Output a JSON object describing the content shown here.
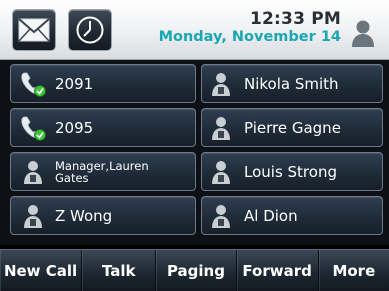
{
  "header": {
    "time": "12:33 PM",
    "date": "Monday, November 14",
    "icons": [
      "envelope-icon",
      "clock-icon",
      "user-avatar-icon"
    ]
  },
  "lines": [
    {
      "label": "2091",
      "icon": "phone-line-icon"
    },
    {
      "label": "Nikola Smith",
      "icon": "contact-icon"
    },
    {
      "label": "2095",
      "icon": "phone-line-icon"
    },
    {
      "label": "Pierre Gagne",
      "icon": "contact-icon"
    },
    {
      "label": "Manager,Lauren Gates",
      "icon": "contact-icon"
    },
    {
      "label": "Louis Strong",
      "icon": "contact-icon"
    },
    {
      "label": "Z Wong",
      "icon": "contact-icon"
    },
    {
      "label": "Al Dion",
      "icon": "contact-icon"
    }
  ],
  "softkeys": [
    {
      "label": "New Call"
    },
    {
      "label": "Talk"
    },
    {
      "label": "Paging"
    },
    {
      "label": "Forward"
    },
    {
      "label": "More"
    }
  ],
  "colors": {
    "date_accent": "#1aa7b3",
    "line_key_bg": "#1f2b38",
    "status_green": "#3ec23a"
  }
}
